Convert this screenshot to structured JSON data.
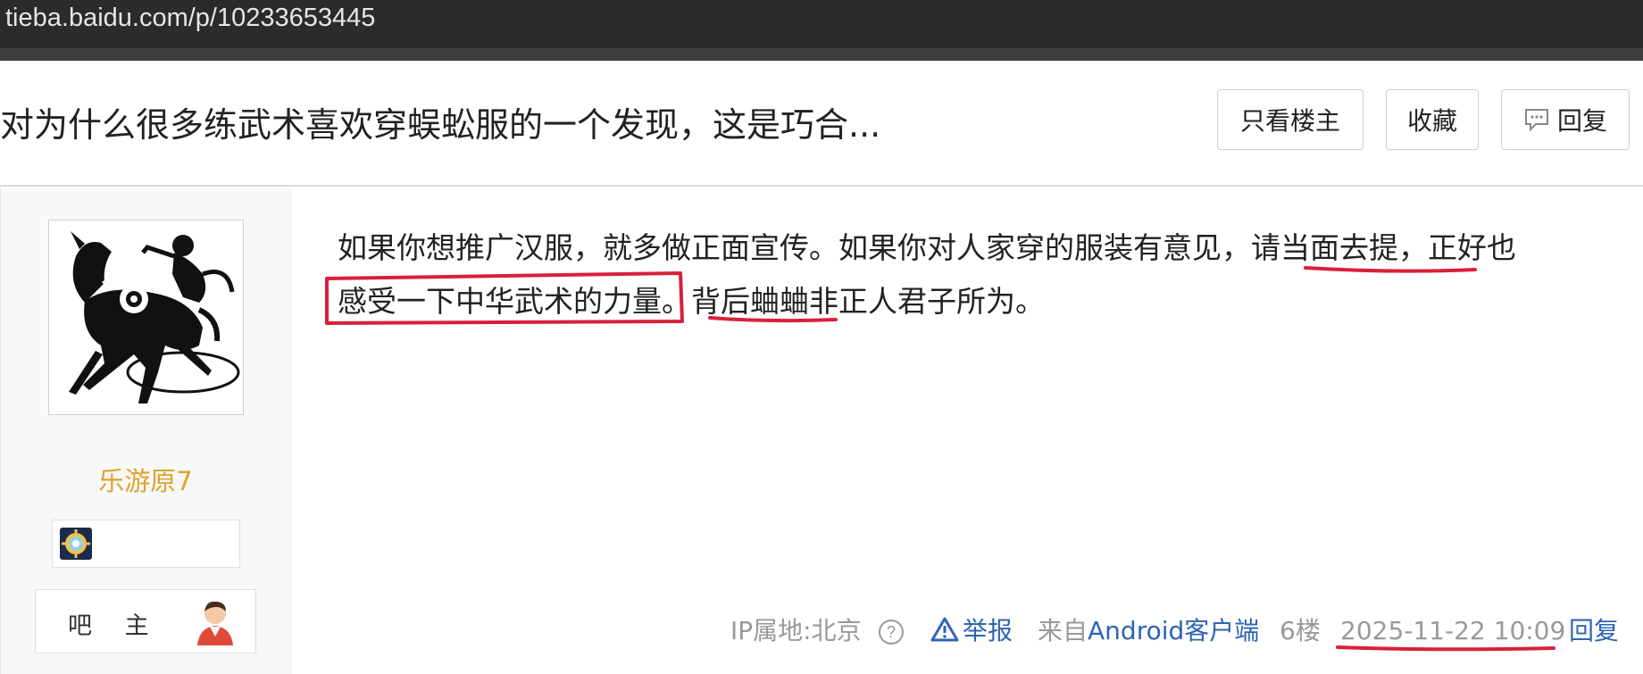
{
  "browser": {
    "url": "tieba.baidu.com/p/10233653445"
  },
  "thread": {
    "title": "对为什么很多练武术喜欢穿蜈蚣服的一个发现，这是巧合...",
    "buttons": {
      "only_op": "只看楼主",
      "favorite": "收藏",
      "reply": "回复"
    }
  },
  "author": {
    "name": "乐游原7",
    "role": "吧 主",
    "avatar_icon": "monkey-on-horse-papercut-avatar",
    "badge_icon": "gear-medal-badge-icon"
  },
  "post": {
    "line1": {
      "a": "如果你想推广汉服，就多做正面宣传。如果你对人家穿的服装有意见，",
      "b": "请当面去提",
      "c": "，正好也"
    },
    "line2": {
      "a": "感受一下中华武术的力量",
      "b": "。",
      "c": "背后蛐蛐",
      "d": "非正人君子所为。"
    }
  },
  "footer": {
    "ip": "IP属地:北京",
    "report": "举报",
    "source_prefix": "来自",
    "source_client": "Android客户端",
    "floor": "6楼",
    "time": "2025-11-22 10:09",
    "reply": "回复"
  },
  "colors": {
    "annotation_red": "#d8203a",
    "link_blue": "#2d64b3",
    "username_orange": "#e0a22b",
    "urlbar_dark": "#2b2b2b"
  }
}
